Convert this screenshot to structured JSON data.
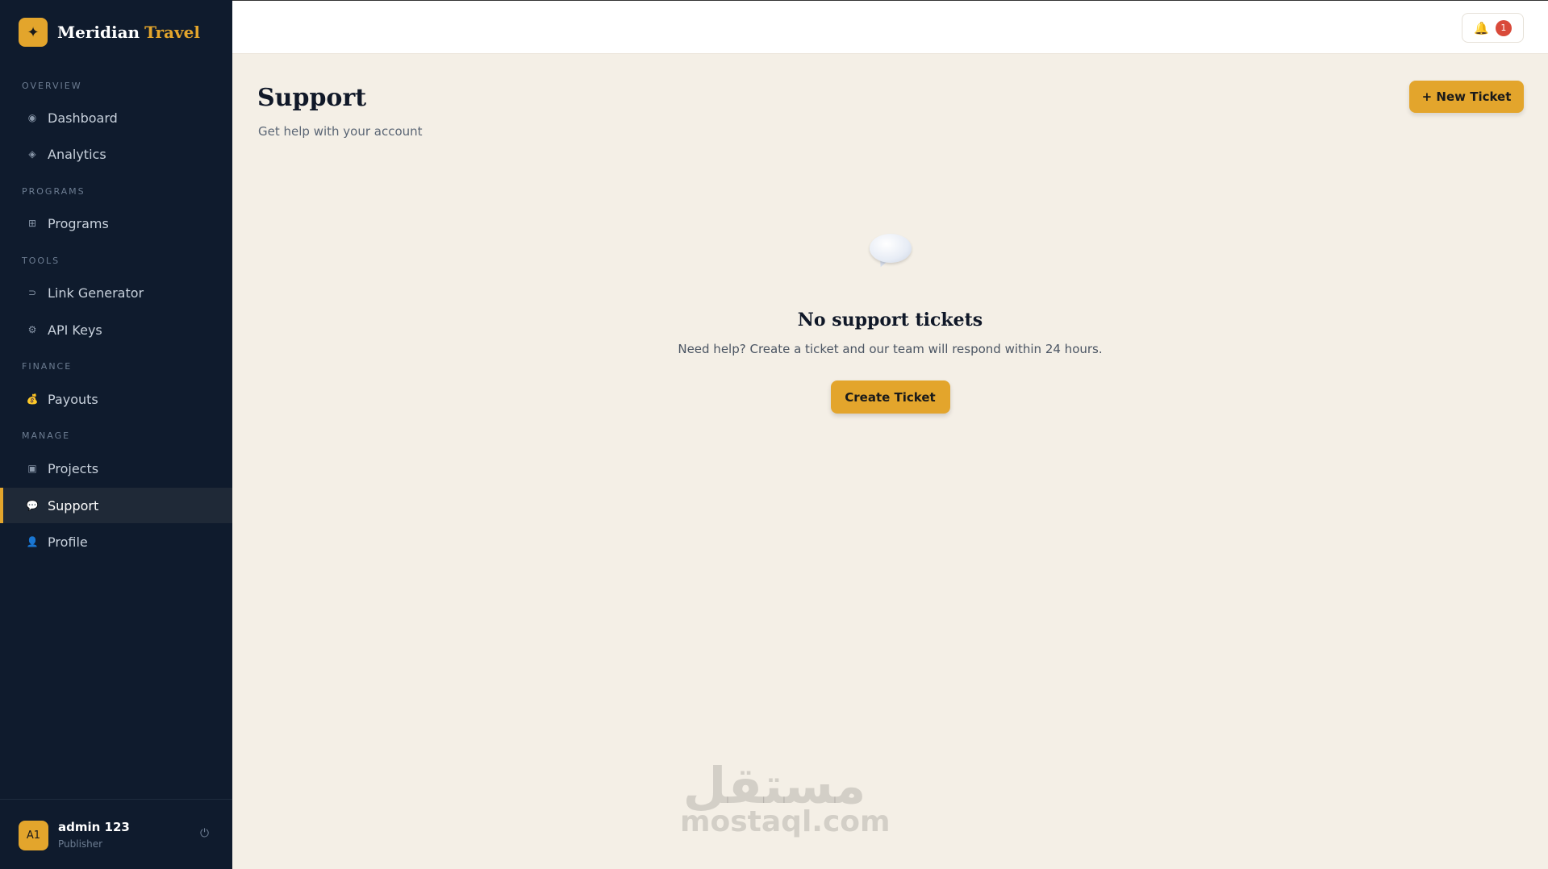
{
  "brand": {
    "logo_glyph": "✦",
    "name": "Meridian",
    "accent": "Travel",
    "accent_color": "#e3a52c"
  },
  "sidebar": {
    "sections": [
      {
        "label": "OVERVIEW"
      },
      {
        "label": "PROGRAMS"
      },
      {
        "label": "TOOLS"
      },
      {
        "label": "FINANCE"
      },
      {
        "label": "MANAGE"
      }
    ],
    "items": [
      {
        "label": "Dashboard",
        "icon": "dashboard-icon",
        "glyph": "◉"
      },
      {
        "label": "Analytics",
        "icon": "analytics-icon",
        "glyph": "◈"
      },
      {
        "label": "Programs",
        "icon": "grid-icon",
        "glyph": "⊞"
      },
      {
        "label": "Link Generator",
        "icon": "link-icon",
        "glyph": "⊃"
      },
      {
        "label": "API Keys",
        "icon": "key-icon",
        "glyph": "⚙"
      },
      {
        "label": "Payouts",
        "icon": "money-bag-icon",
        "glyph": "💰"
      },
      {
        "label": "Projects",
        "icon": "projects-icon",
        "glyph": "▣"
      },
      {
        "label": "Support",
        "icon": "speech-bubble-icon",
        "glyph": "💬",
        "active": true
      },
      {
        "label": "Profile",
        "icon": "user-icon",
        "glyph": "👤"
      }
    ],
    "user": {
      "initials": "A1",
      "name": "admin 123",
      "role": "Publisher",
      "logout_glyph": "⏻"
    }
  },
  "topbar": {
    "bell_glyph": "🔔",
    "notification_count": "1"
  },
  "page": {
    "title": "Support",
    "subtitle": "Get help with your account",
    "new_ticket_label": "+ New Ticket"
  },
  "empty_state": {
    "title": "No support tickets",
    "text": "Need help? Create a ticket and our team will respond within 24 hours.",
    "button_label": "Create Ticket"
  },
  "watermark": {
    "arabic": "مستقل",
    "latin": "mostaql.com"
  },
  "colors": {
    "sidebar_bg": "#0f1b2d",
    "accent": "#e3a52c",
    "page_bg": "#f4efe6",
    "badge": "#d94a3a"
  }
}
